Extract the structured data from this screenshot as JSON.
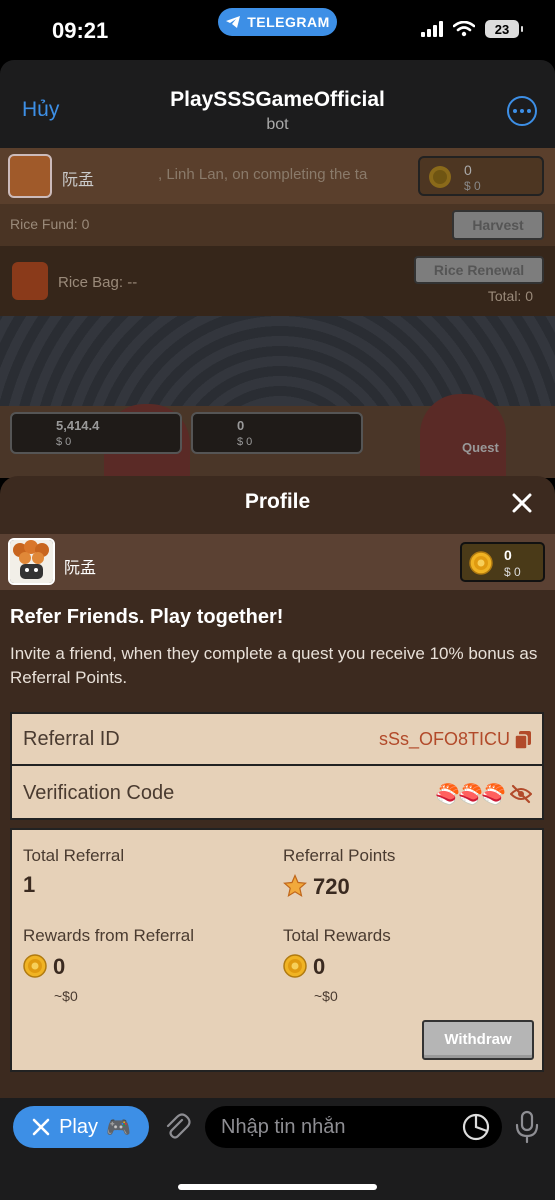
{
  "status_bar": {
    "time": "09:21",
    "app_pill": "TELEGRAM",
    "battery": "23"
  },
  "telegram_header": {
    "cancel_label": "Hủy",
    "title": "PlaySSSGameOfficial",
    "subtitle": "bot"
  },
  "game_background": {
    "player_name": "阮孟",
    "marquee": ", Linh Lan, on completing the ta",
    "coin_value": "0",
    "coin_usd": "$ 0",
    "rice_fund": "Rice Fund: 0",
    "harvest_label": "Harvest",
    "rice_bag": "Rice Bag: --",
    "rice_renewal_label": "Rice Renewal",
    "total": "Total: 0",
    "stat1_value": "5,414.4",
    "stat1_usd": "$ 0",
    "stat2_value": "0",
    "stat2_usd": "$ 0",
    "quest_label": "Quest"
  },
  "profile": {
    "title": "Profile",
    "username": "阮孟",
    "coin_value": "0",
    "coin_usd": "$ 0",
    "refer_title": "Refer Friends. Play together!",
    "refer_desc": "Invite a friend, when they complete a quest you receive 10% bonus as Referral Points.",
    "referral_id_label": "Referral ID",
    "referral_id_value": "sSs_OFO8TICU",
    "verification_label": "Verification Code",
    "verification_value": "🍣🍣🍣",
    "stats": {
      "total_referral_label": "Total Referral",
      "total_referral_value": "1",
      "referral_points_label": "Referral Points",
      "referral_points_value": "720",
      "rewards_label": "Rewards from Referral",
      "rewards_value": "0",
      "rewards_usd": "~$0",
      "total_rewards_label": "Total Rewards",
      "total_rewards_value": "0",
      "total_rewards_usd": "~$0"
    },
    "withdraw_label": "Withdraw"
  },
  "input_bar": {
    "play_label": "Play",
    "play_emoji": "🎮",
    "placeholder": "Nhập tin nhắn"
  },
  "colors": {
    "telegram_blue": "#3d8fe6",
    "sheet_bg": "#3c2a1f",
    "card_bg": "#e6d1b8",
    "accent_id": "#b24a2a"
  }
}
